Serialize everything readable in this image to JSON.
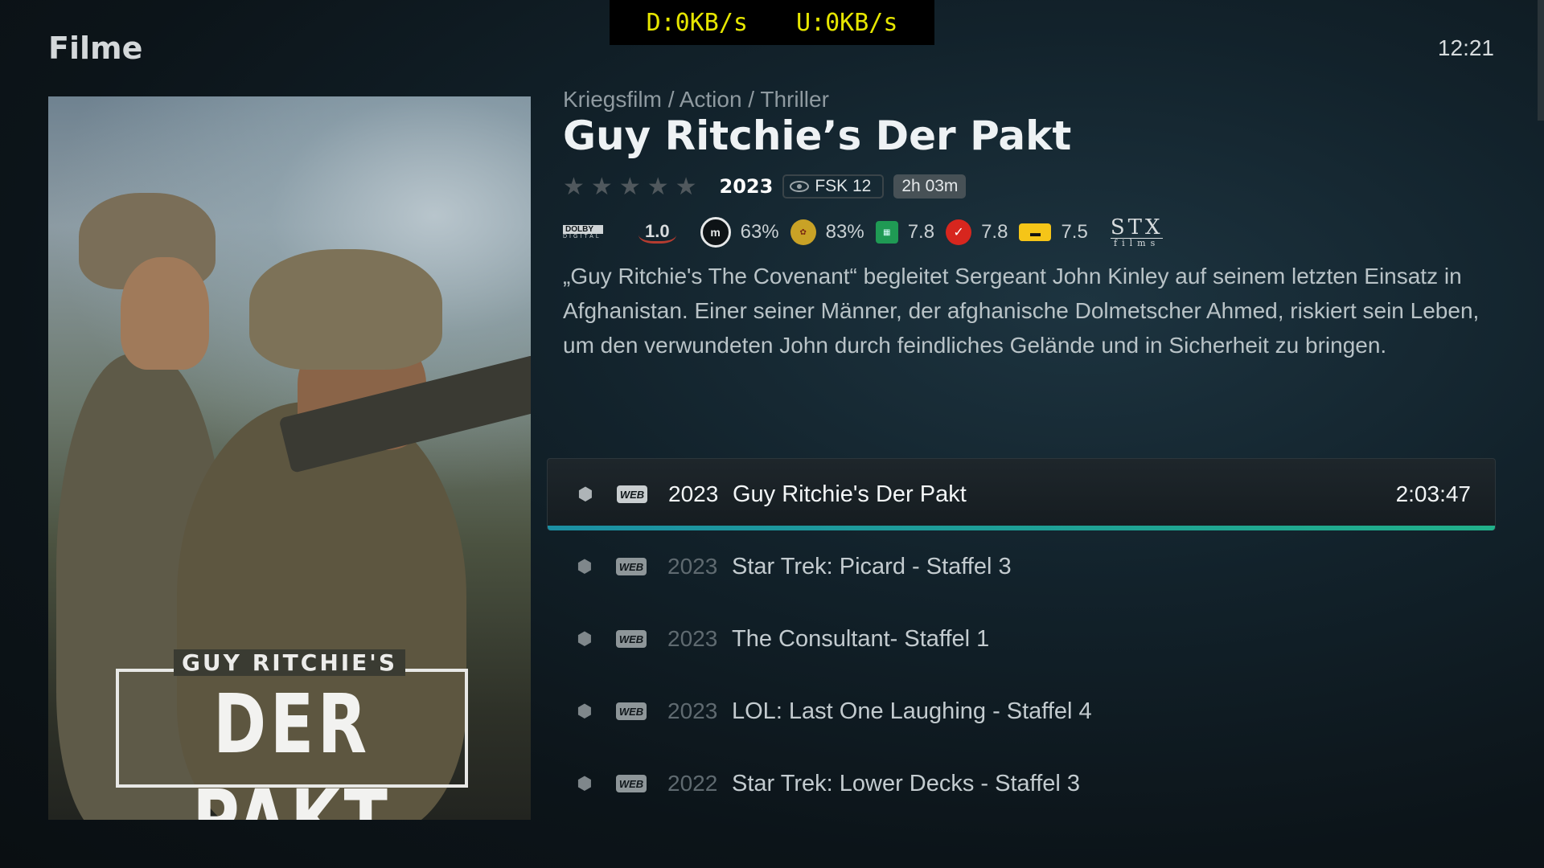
{
  "header": {
    "title": "Filme",
    "clock": "12:21"
  },
  "network": {
    "download": "D:0KB/s",
    "upload": "U:0KB/s"
  },
  "poster": {
    "line1": "GUY RITCHIE'S",
    "line2": "DER PAKT"
  },
  "movie": {
    "genres": "Kriegsfilm / Action / Thriller",
    "title": "Guy Ritchie’s Der Pakt",
    "user_rating_stars": 0,
    "year": "2023",
    "fsk": "FSK 12",
    "duration": "2h 03m",
    "audio_codec": {
      "top": "DOLBY",
      "bottom": "DIGITAL"
    },
    "audio_channels": "1.0",
    "ratings": {
      "metacritic": "63%",
      "rotten_tomatoes": "83%",
      "tmdb": "7.8",
      "trakt": "7.8",
      "imdb": "7.5"
    },
    "studio": {
      "top": "STX",
      "bottom": "films"
    },
    "plot": "„Guy Ritchie's The Covenant“ begleitet Sergeant John Kinley auf seinem letzten Einsatz in Afghanistan. Einer seiner Männer, der afghanische Dolmetscher Ahmed, riskiert sein Leben, um den verwundeten John durch feindliches Gelände und in Sicherheit zu bringen."
  },
  "list": {
    "badge": "WEB",
    "items": [
      {
        "year": "2023",
        "title": "Guy Ritchie's Der Pakt",
        "time": "2:03:47",
        "selected": true
      },
      {
        "year": "2023",
        "title": "Star Trek: Picard - Staffel 3",
        "time": ""
      },
      {
        "year": "2023",
        "title": "The Consultant- Staffel 1",
        "time": ""
      },
      {
        "year": "2023",
        "title": "LOL: Last One Laughing - Staffel 4",
        "time": ""
      },
      {
        "year": "2022",
        "title": "Star Trek: Lower Decks - Staffel 3",
        "time": ""
      }
    ]
  },
  "colors": {
    "accent_start": "#1c8fa3",
    "accent_end": "#21b08a",
    "net_text": "#e6e600"
  }
}
